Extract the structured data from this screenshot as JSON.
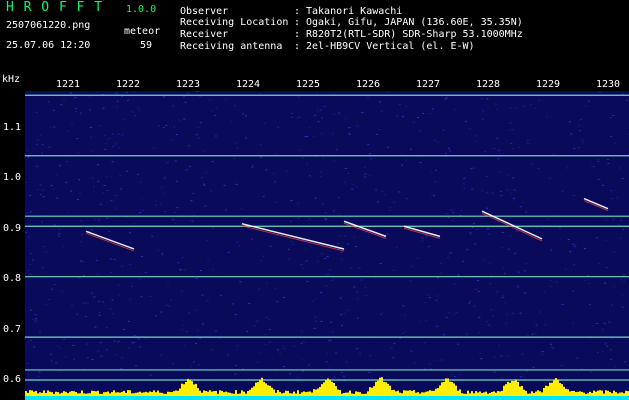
{
  "header": {
    "app_name": "H R O F F T",
    "version": "1.0.0",
    "filename": "2507061220.png",
    "label_meteor": "meteor",
    "datetime": "25.07.06 12:20",
    "meteor_count": "59",
    "info": [
      {
        "key": "Observer",
        "sep": ":",
        "value": "Takanori Kawachi"
      },
      {
        "key": "Receiving Location",
        "sep": ":",
        "value": "Ogaki, Gifu, JAPAN (136.60E, 35.35N)"
      },
      {
        "key": "Receiver",
        "sep": ":",
        "value": "R820T2(RTL-SDR) SDR-Sharp 53.1000MHz"
      },
      {
        "key": "Receiving antenna",
        "sep": ":",
        "value": "2el-HB9CV Vertical (el. E-W)"
      }
    ]
  },
  "y_unit": "kHz",
  "chart_data": {
    "type": "heatmap",
    "title": "",
    "xlabel": "",
    "ylabel": "kHz",
    "x_ticks": [
      "1221",
      "1222",
      "1223",
      "1224",
      "1225",
      "1226",
      "1227",
      "1228",
      "1229",
      "1230"
    ],
    "y_ticks": [
      "1.1",
      "1.0",
      "0.9",
      "0.8",
      "0.7",
      "0.6"
    ],
    "ylim": [
      0.58,
      1.2
    ],
    "background": "#0a0a5a",
    "carrier_lines_khz": [
      1.165,
      1.045,
      0.925,
      0.905,
      0.805,
      0.685,
      0.62,
      0.6
    ],
    "meteor_streaks": [
      {
        "x1": 1221.3,
        "y1": 0.895,
        "x2": 1222.1,
        "y2": 0.86
      },
      {
        "x1": 1223.9,
        "y1": 0.91,
        "x2": 1225.6,
        "y2": 0.86
      },
      {
        "x1": 1225.6,
        "y1": 0.915,
        "x2": 1226.3,
        "y2": 0.885
      },
      {
        "x1": 1226.6,
        "y1": 0.905,
        "x2": 1227.2,
        "y2": 0.885
      },
      {
        "x1": 1227.9,
        "y1": 0.935,
        "x2": 1228.9,
        "y2": 0.88
      },
      {
        "x1": 1229.6,
        "y1": 0.96,
        "x2": 1230.0,
        "y2": 0.94
      }
    ],
    "activity_bumps": [
      1223.0,
      1224.2,
      1225.3,
      1226.2,
      1227.3,
      1228.4,
      1229.1
    ]
  },
  "colors": {
    "header_text": "#00ff66",
    "axis_text": "#ffffff",
    "carrier_line": "#7fffd4",
    "bar_fill": "#ffee00",
    "bar_base": "#00e5ff"
  }
}
